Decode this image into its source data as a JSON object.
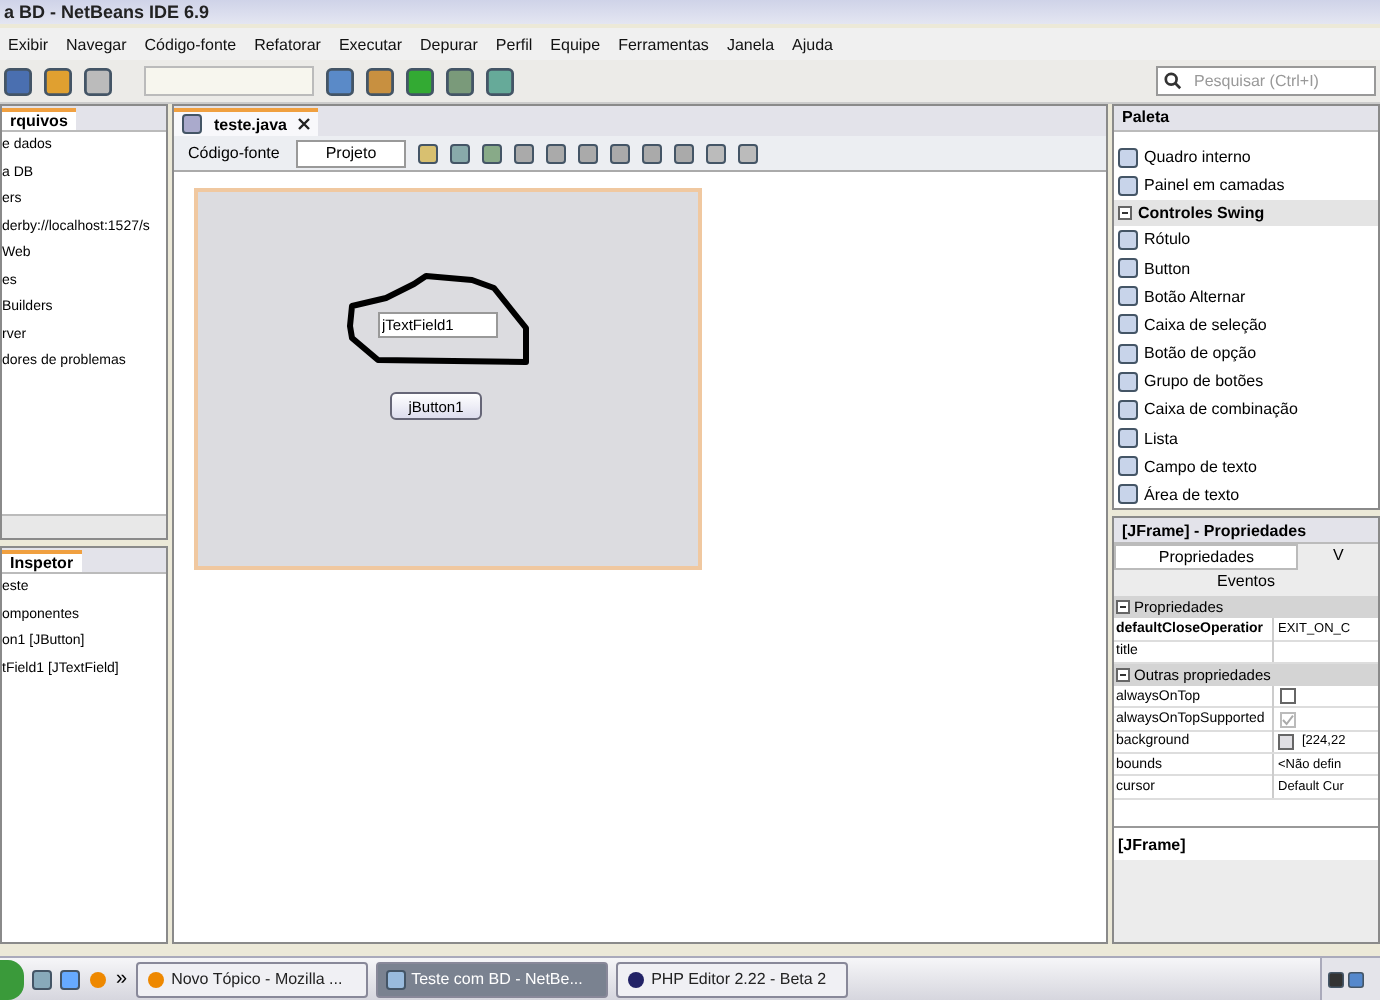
{
  "window": {
    "title": "a BD - NetBeans IDE 6.9"
  },
  "menu": [
    "Exibir",
    "Navegar",
    "Código-fonte",
    "Refatorar",
    "Executar",
    "Depurar",
    "Perfil",
    "Equipe",
    "Ferramentas",
    "Janela",
    "Ajuda"
  ],
  "toolbar": {
    "search": {
      "placeholder": "Pesquisar (Ctrl+I)"
    }
  },
  "files_panel": {
    "tab": "rquivos",
    "items": [
      "e dados",
      "a DB",
      "ers",
      "derby://localhost:1527/s",
      "Web",
      "es",
      "Builders",
      "rver",
      "dores de problemas"
    ]
  },
  "inspector": {
    "title": "Inspetor",
    "tree": [
      {
        "label": "este",
        "children": [
          {
            "label": "omponentes",
            "children": [
              {
                "label": "on1 [JButton]"
              },
              {
                "label": "tField1 [JTextField]"
              }
            ]
          }
        ]
      }
    ]
  },
  "editor": {
    "tabs": [
      {
        "label": "teste.java",
        "selected": true
      }
    ],
    "views": [
      {
        "label": "Código-fonte",
        "selected": false
      },
      {
        "label": "Projeto",
        "selected": true
      }
    ],
    "form": {
      "text_field": {
        "value": "jTextField1"
      },
      "button": {
        "label": "jButton1"
      }
    }
  },
  "palette": {
    "title": "Paleta",
    "items": [
      {
        "kind": "item",
        "label": "Quadro interno"
      },
      {
        "kind": "item",
        "label": "Painel em camadas"
      },
      {
        "kind": "category",
        "label": "Controles Swing",
        "expanded": true
      },
      {
        "kind": "item",
        "label": "Rótulo"
      },
      {
        "kind": "item",
        "label": "Button"
      },
      {
        "kind": "item",
        "label": "Botão Alternar"
      },
      {
        "kind": "item",
        "label": "Caixa de seleção"
      },
      {
        "kind": "item",
        "label": "Botão de opção"
      },
      {
        "kind": "item",
        "label": "Grupo de botões"
      },
      {
        "kind": "item",
        "label": "Caixa de combinação"
      },
      {
        "kind": "item",
        "label": "Lista"
      },
      {
        "kind": "item",
        "label": "Campo de texto"
      },
      {
        "kind": "item",
        "label": "Área de texto"
      }
    ]
  },
  "properties": {
    "title": "[JFrame] - Propriedades",
    "tabs": [
      {
        "label": "Propriedades",
        "selected": true
      },
      {
        "label": "V",
        "selected": false
      },
      {
        "label": "Eventos",
        "selected": false
      }
    ],
    "sections": [
      {
        "title": "Propriedades",
        "expanded": true,
        "rows": [
          {
            "name": "defaultCloseOperatior",
            "kind": "text",
            "bold": true,
            "value": "EXIT_ON_C"
          },
          {
            "name": "title",
            "kind": "text",
            "bold": false
          }
        ]
      },
      {
        "title": "Outras propriedades",
        "expanded": true,
        "rows": [
          {
            "name": "alwaysOnTop",
            "kind": "checkbox",
            "checked": false,
            "disabled": false
          },
          {
            "name": "alwaysOnTopSupported",
            "kind": "checkbox",
            "checked": true,
            "disabled": true
          },
          {
            "name": "background",
            "kind": "color",
            "value": "[224,22"
          },
          {
            "name": "bounds",
            "kind": "text",
            "bold": false,
            "value": "<Não defin"
          },
          {
            "name": "cursor",
            "kind": "text",
            "bold": false,
            "value": "Default Cur"
          }
        ]
      }
    ],
    "footer": "[JFrame]"
  },
  "taskbar": {
    "overflow": "»",
    "tasks": [
      {
        "label": "Novo Tópico - Mozilla ...",
        "selected": false
      },
      {
        "label": "Teste com BD - NetBe...",
        "selected": true
      },
      {
        "label": "PHP Editor 2.22 - Beta 2",
        "selected": false
      }
    ]
  }
}
